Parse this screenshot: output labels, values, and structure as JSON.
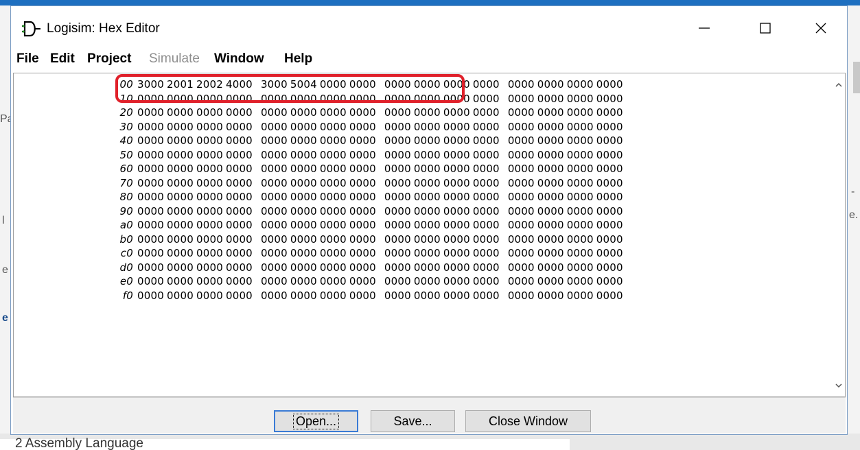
{
  "background": {
    "bottom_text": "2 Assembly Language",
    "fragments": [
      "Pa",
      "l",
      "e",
      "e",
      "-",
      "e."
    ]
  },
  "window": {
    "title": "Logisim: Hex Editor",
    "icons": {
      "app": "logisim-gate-icon",
      "minimize": "minimize-icon",
      "maximize": "maximize-icon",
      "close": "close-icon"
    }
  },
  "menu": {
    "items": [
      {
        "label": "File",
        "enabled": true
      },
      {
        "label": "Edit",
        "enabled": true
      },
      {
        "label": "Project",
        "enabled": true
      },
      {
        "label": "Simulate",
        "enabled": false
      },
      {
        "label": "Window",
        "enabled": true
      },
      {
        "label": "Help",
        "enabled": true
      }
    ]
  },
  "hex": {
    "rows": [
      {
        "addr": "00",
        "words": [
          "3000",
          "2001",
          "2002",
          "4000",
          "3000",
          "5004",
          "0000",
          "0000",
          "0000",
          "0000",
          "0000",
          "0000",
          "0000",
          "0000",
          "0000",
          "0000"
        ]
      },
      {
        "addr": "10",
        "words": [
          "0000",
          "0000",
          "0000",
          "0000",
          "0000",
          "0000",
          "0000",
          "0000",
          "0000",
          "0000",
          "0000",
          "0000",
          "0000",
          "0000",
          "0000",
          "0000"
        ]
      },
      {
        "addr": "20",
        "words": [
          "0000",
          "0000",
          "0000",
          "0000",
          "0000",
          "0000",
          "0000",
          "0000",
          "0000",
          "0000",
          "0000",
          "0000",
          "0000",
          "0000",
          "0000",
          "0000"
        ]
      },
      {
        "addr": "30",
        "words": [
          "0000",
          "0000",
          "0000",
          "0000",
          "0000",
          "0000",
          "0000",
          "0000",
          "0000",
          "0000",
          "0000",
          "0000",
          "0000",
          "0000",
          "0000",
          "0000"
        ]
      },
      {
        "addr": "40",
        "words": [
          "0000",
          "0000",
          "0000",
          "0000",
          "0000",
          "0000",
          "0000",
          "0000",
          "0000",
          "0000",
          "0000",
          "0000",
          "0000",
          "0000",
          "0000",
          "0000"
        ]
      },
      {
        "addr": "50",
        "words": [
          "0000",
          "0000",
          "0000",
          "0000",
          "0000",
          "0000",
          "0000",
          "0000",
          "0000",
          "0000",
          "0000",
          "0000",
          "0000",
          "0000",
          "0000",
          "0000"
        ]
      },
      {
        "addr": "60",
        "words": [
          "0000",
          "0000",
          "0000",
          "0000",
          "0000",
          "0000",
          "0000",
          "0000",
          "0000",
          "0000",
          "0000",
          "0000",
          "0000",
          "0000",
          "0000",
          "0000"
        ]
      },
      {
        "addr": "70",
        "words": [
          "0000",
          "0000",
          "0000",
          "0000",
          "0000",
          "0000",
          "0000",
          "0000",
          "0000",
          "0000",
          "0000",
          "0000",
          "0000",
          "0000",
          "0000",
          "0000"
        ]
      },
      {
        "addr": "80",
        "words": [
          "0000",
          "0000",
          "0000",
          "0000",
          "0000",
          "0000",
          "0000",
          "0000",
          "0000",
          "0000",
          "0000",
          "0000",
          "0000",
          "0000",
          "0000",
          "0000"
        ]
      },
      {
        "addr": "90",
        "words": [
          "0000",
          "0000",
          "0000",
          "0000",
          "0000",
          "0000",
          "0000",
          "0000",
          "0000",
          "0000",
          "0000",
          "0000",
          "0000",
          "0000",
          "0000",
          "0000"
        ]
      },
      {
        "addr": "a0",
        "words": [
          "0000",
          "0000",
          "0000",
          "0000",
          "0000",
          "0000",
          "0000",
          "0000",
          "0000",
          "0000",
          "0000",
          "0000",
          "0000",
          "0000",
          "0000",
          "0000"
        ]
      },
      {
        "addr": "b0",
        "words": [
          "0000",
          "0000",
          "0000",
          "0000",
          "0000",
          "0000",
          "0000",
          "0000",
          "0000",
          "0000",
          "0000",
          "0000",
          "0000",
          "0000",
          "0000",
          "0000"
        ]
      },
      {
        "addr": "c0",
        "words": [
          "0000",
          "0000",
          "0000",
          "0000",
          "0000",
          "0000",
          "0000",
          "0000",
          "0000",
          "0000",
          "0000",
          "0000",
          "0000",
          "0000",
          "0000",
          "0000"
        ]
      },
      {
        "addr": "d0",
        "words": [
          "0000",
          "0000",
          "0000",
          "0000",
          "0000",
          "0000",
          "0000",
          "0000",
          "0000",
          "0000",
          "0000",
          "0000",
          "0000",
          "0000",
          "0000",
          "0000"
        ]
      },
      {
        "addr": "e0",
        "words": [
          "0000",
          "0000",
          "0000",
          "0000",
          "0000",
          "0000",
          "0000",
          "0000",
          "0000",
          "0000",
          "0000",
          "0000",
          "0000",
          "0000",
          "0000",
          "0000"
        ]
      },
      {
        "addr": "f0",
        "words": [
          "0000",
          "0000",
          "0000",
          "0000",
          "0000",
          "0000",
          "0000",
          "0000",
          "0000",
          "0000",
          "0000",
          "0000",
          "0000",
          "0000",
          "0000",
          "0000"
        ]
      }
    ],
    "highlight_color": "#e0202a",
    "scroll_icons": [
      "scroll-up-icon",
      "scroll-down-icon"
    ]
  },
  "buttons": {
    "open": "Open...",
    "save": "Save...",
    "close": "Close Window"
  }
}
